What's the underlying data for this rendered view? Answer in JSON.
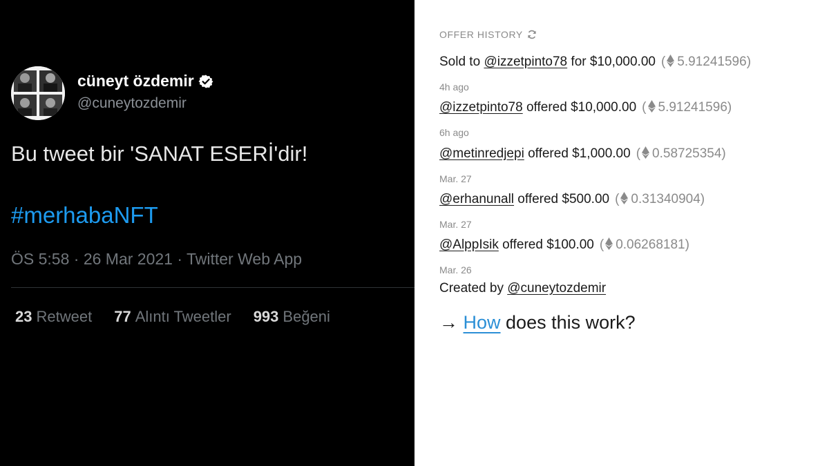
{
  "tweet": {
    "display_name": "cüneyt özdemir",
    "username": "@cuneytozdemir",
    "text": "Bu tweet bir 'SANAT ESERİ'dir!",
    "hashtag": "#merhabaNFT",
    "meta": "ÖS 5:58 · 26 Mar 2021 · Twitter Web App",
    "stats": [
      {
        "count": "23",
        "label": "Retweet"
      },
      {
        "count": "77",
        "label": "Alıntı Tweetler"
      },
      {
        "count": "993",
        "label": "Beğeni"
      }
    ],
    "verified_icon": "verified-badge-icon",
    "avatar": "avatar-collage"
  },
  "offer_history": {
    "header": "OFFER HISTORY",
    "refresh_icon": "refresh-icon",
    "entries": [
      {
        "prefix": "Sold to ",
        "user": "@izzetpinto78",
        "mid": " for $10,000.00",
        "eth": "5.91241596",
        "time": "4h ago"
      },
      {
        "prefix": "",
        "user": "@izzetpinto78",
        "mid": " offered $10,000.00",
        "eth": "5.91241596",
        "time": "6h ago"
      },
      {
        "prefix": "",
        "user": "@metinredjepi",
        "mid": " offered $1,000.00",
        "eth": "0.58725354",
        "time": "Mar. 27"
      },
      {
        "prefix": "",
        "user": "@erhanunall",
        "mid": " offered $500.00",
        "eth": "0.31340904",
        "time": "Mar. 27"
      },
      {
        "prefix": "",
        "user": "@AlppIsik",
        "mid": " offered $100.00",
        "eth": "0.06268181",
        "time": "Mar. 26"
      }
    ],
    "created": {
      "prefix": "Created by ",
      "user": "@cuneytozdemir"
    },
    "how": {
      "arrow": "→",
      "link": "How",
      "rest": " does this work?"
    }
  },
  "colors": {
    "left_bg": "#000000",
    "hashtag": "#1d9bf0",
    "how_link": "#2b8fd6",
    "muted": "#8a8a8a"
  }
}
